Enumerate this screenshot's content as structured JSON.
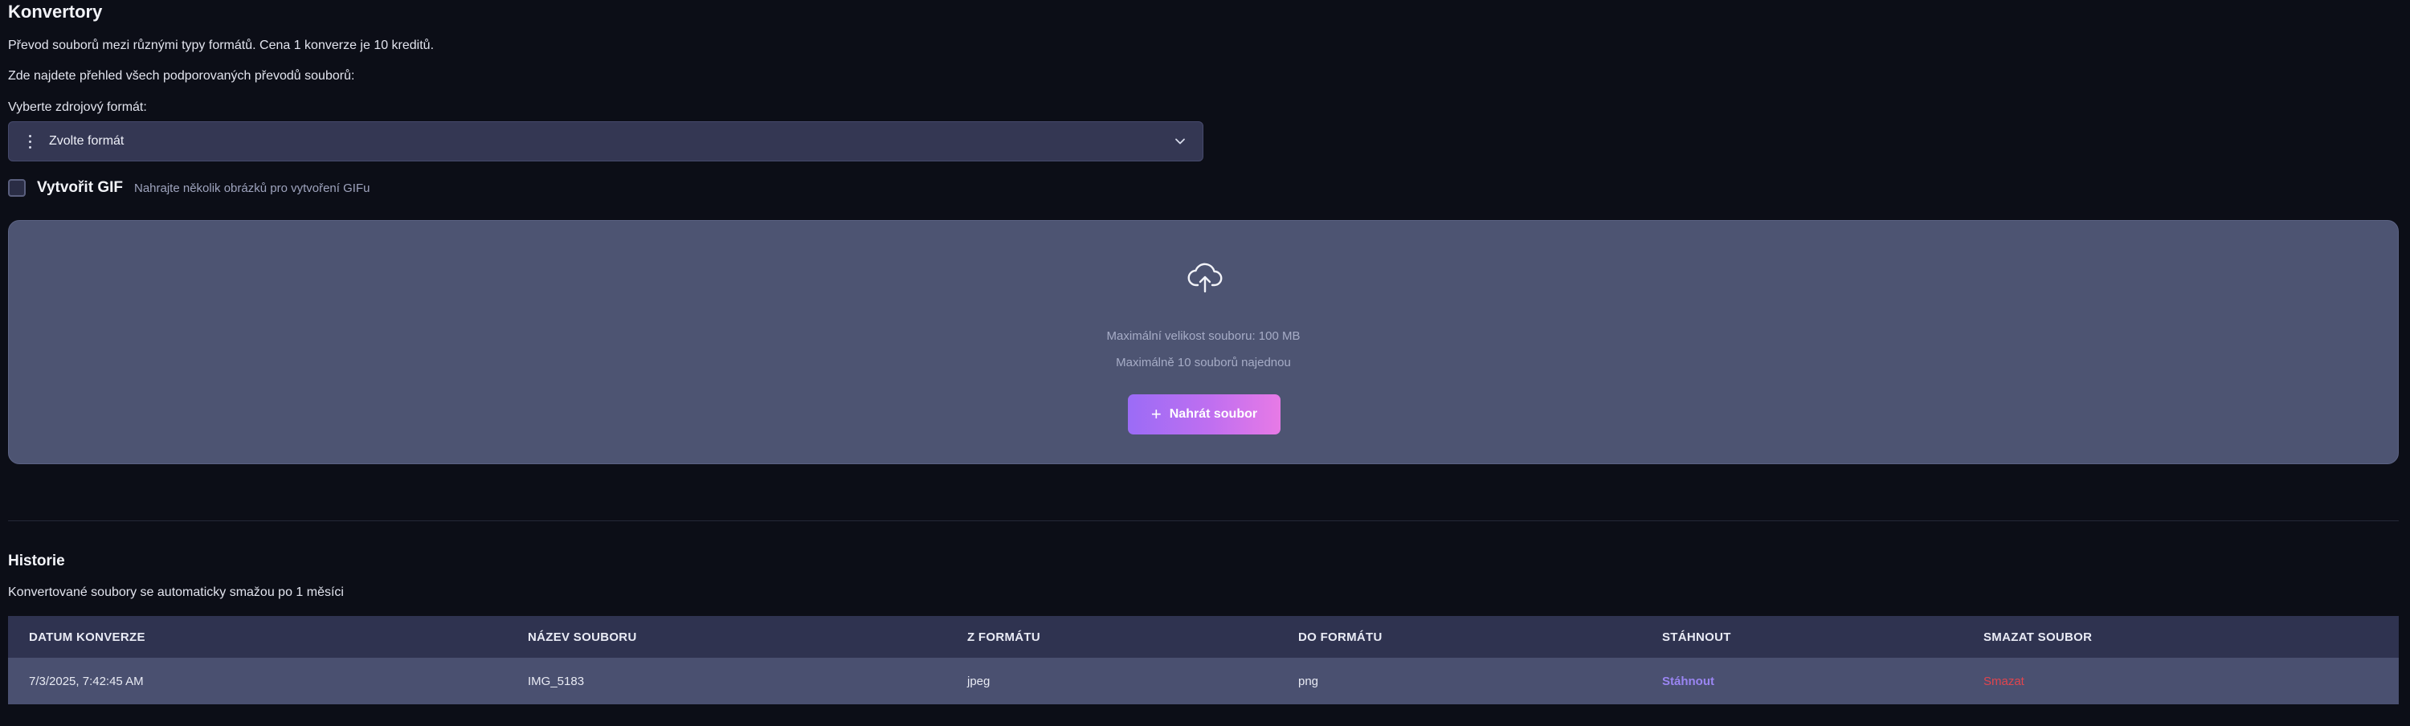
{
  "header": {
    "title": "Konvertory",
    "subtitle": "Převod souborů mezi různými typy formátů. Cena 1 konverze je 10 kreditů.",
    "overview": "Zde najdete přehled všech podporovaných převodů souborů:"
  },
  "source_format": {
    "label": "Vyberte zdrojový formát:",
    "selected": "Zvolte formát"
  },
  "gif": {
    "label": "Vytvořit GIF",
    "hint": "Nahrajte několik obrázků pro vytvoření GIFu",
    "checked": false
  },
  "dropzone": {
    "max_size": "Maximální velikost souboru: 100 MB",
    "max_files": "Maximálně 10 souborů najednou",
    "upload_label": "Nahrát soubor"
  },
  "history": {
    "title": "Historie",
    "subtitle": "Konvertované soubory se automaticky smažou po 1 měsíci",
    "columns": [
      "DATUM KONVERZE",
      "NÁZEV SOUBORU",
      "Z FORMÁTU",
      "DO FORMÁTU",
      "STÁHNOUT",
      "SMAZAT SOUBOR"
    ],
    "rows": [
      {
        "date": "7/3/2025, 7:42:45 AM",
        "name": "IMG_5183",
        "from": "jpeg",
        "to": "png",
        "download": "Stáhnout",
        "delete": "Smazat"
      }
    ]
  },
  "colors": {
    "background": "#0c0e17",
    "accent_start": "#9b6cf6",
    "accent_end": "#e77ae6",
    "download_link": "#9a85f2",
    "delete_link": "#e0454e"
  },
  "icons": [
    "more-vertical-icon",
    "chevron-down-icon",
    "upload-cloud-icon",
    "plus-icon"
  ]
}
